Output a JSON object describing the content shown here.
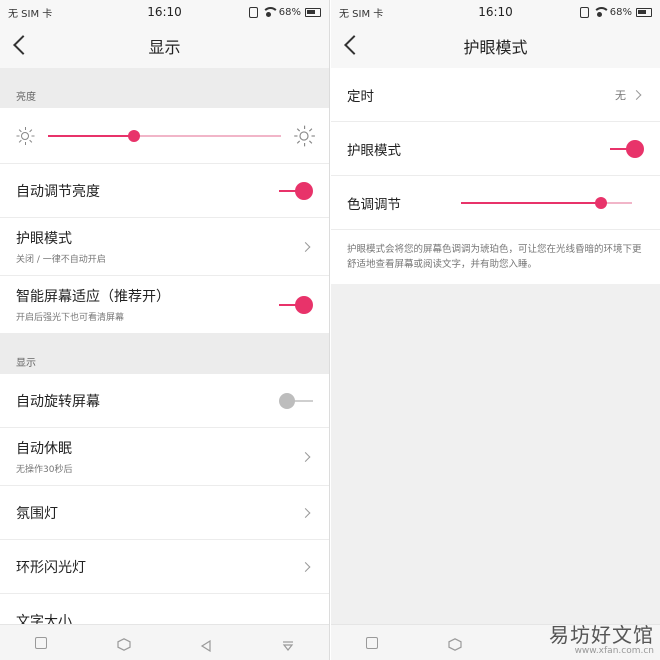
{
  "left": {
    "status": {
      "carrier": "无 SIM 卡",
      "time": "16:10",
      "battery": "68%"
    },
    "title": "显示",
    "section_brightness": "亮度",
    "brightness_level": 0.37,
    "auto_brightness": {
      "label": "自动调节亮度",
      "on": true
    },
    "eye_care": {
      "label": "护眼模式",
      "sub": "关闭 / 一律不自动开启"
    },
    "smart_adapt": {
      "label": "智能屏幕适应（推荐开）",
      "sub": "开启后强光下也可看清屏幕",
      "on": true
    },
    "section_display": "显示",
    "auto_rotate": {
      "label": "自动旋转屏幕",
      "on": false
    },
    "auto_sleep": {
      "label": "自动休眠",
      "sub": "无操作30秒后"
    },
    "ambient_light": {
      "label": "氛围灯"
    },
    "ring_flash": {
      "label": "环形闪光灯"
    },
    "font_size": {
      "label": "文字大小"
    }
  },
  "right": {
    "status": {
      "carrier": "无 SIM 卡",
      "time": "16:10",
      "battery": "68%"
    },
    "title": "护眼模式",
    "schedule": {
      "label": "定时",
      "value": "无"
    },
    "eye_care_toggle": {
      "label": "护眼模式",
      "on": true
    },
    "tone": {
      "label": "色调调节",
      "level": 0.82
    },
    "description": "护眼模式会将您的屏幕色调调为琥珀色，可让您在光线昏暗的环境下更舒适地查看屏幕或阅读文字，并有助您入睡。"
  },
  "watermark": {
    "main": "易坊好文馆",
    "sub": "www.xfan.com.cn"
  },
  "colors": {
    "accent": "#e8336a",
    "track_light": "#f1b5c8",
    "section_bg": "#ececec"
  }
}
